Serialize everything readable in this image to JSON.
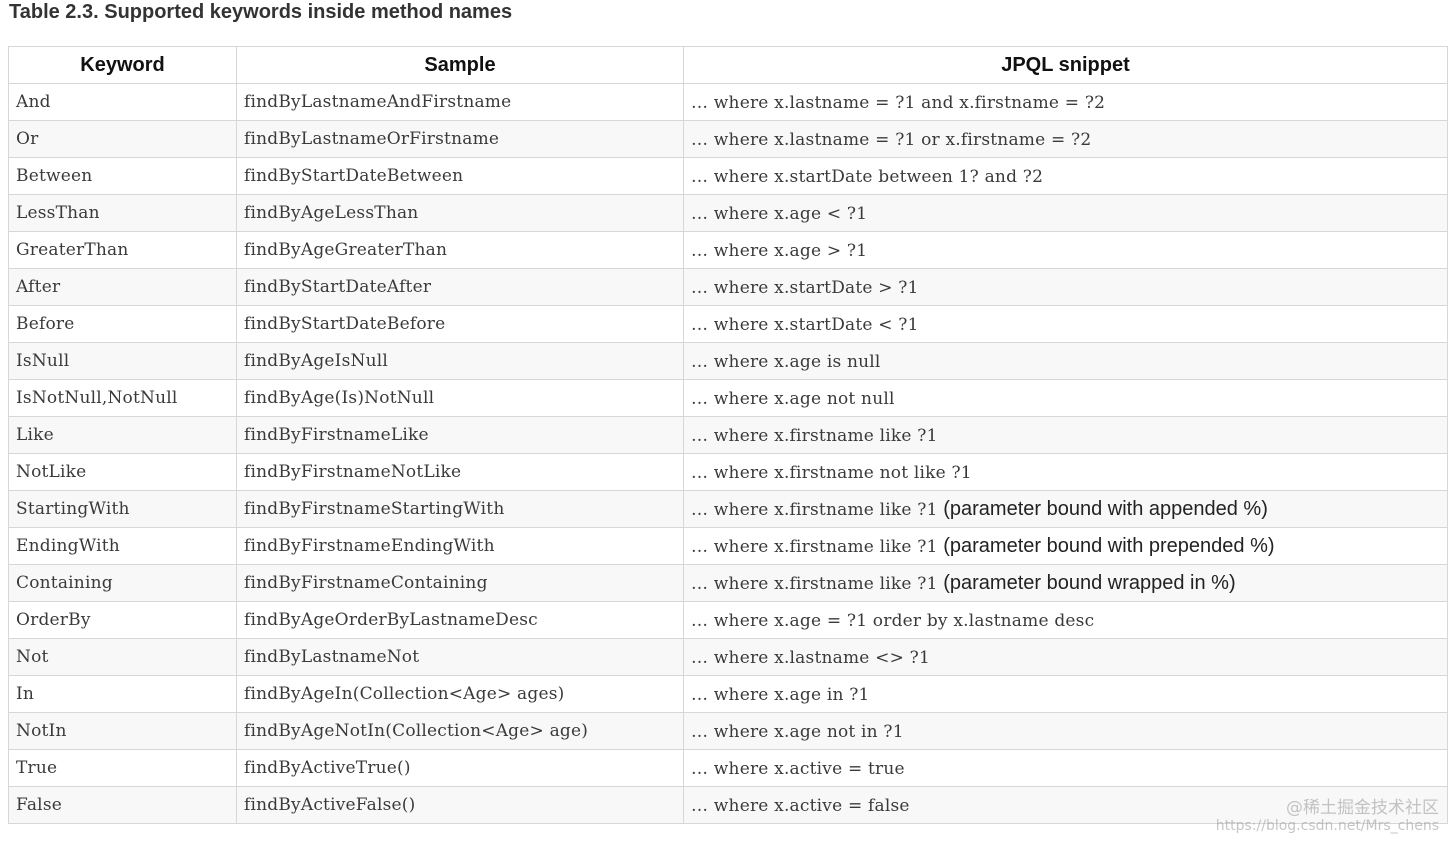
{
  "title": "Table 2.3. Supported keywords inside method names",
  "table": {
    "headers": [
      "Keyword",
      "Sample",
      "JPQL snippet"
    ],
    "rows": [
      {
        "keyword": "And",
        "sample": "findByLastnameAndFirstname",
        "jpql": "… where x.lastname = ?1 and x.firstname = ?2",
        "note": ""
      },
      {
        "keyword": "Or",
        "sample": "findByLastnameOrFirstname",
        "jpql": "… where x.lastname = ?1 or x.firstname = ?2",
        "note": ""
      },
      {
        "keyword": "Between",
        "sample": "findByStartDateBetween",
        "jpql": "… where x.startDate between 1? and ?2",
        "note": ""
      },
      {
        "keyword": "LessThan",
        "sample": "findByAgeLessThan",
        "jpql": "… where x.age < ?1",
        "note": ""
      },
      {
        "keyword": "GreaterThan",
        "sample": "findByAgeGreaterThan",
        "jpql": "… where x.age > ?1",
        "note": ""
      },
      {
        "keyword": "After",
        "sample": "findByStartDateAfter",
        "jpql": "… where x.startDate > ?1",
        "note": ""
      },
      {
        "keyword": "Before",
        "sample": "findByStartDateBefore",
        "jpql": "… where x.startDate < ?1",
        "note": ""
      },
      {
        "keyword": "IsNull",
        "sample": "findByAgeIsNull",
        "jpql": "… where x.age is null",
        "note": ""
      },
      {
        "keyword": "IsNotNull,NotNull",
        "sample": "findByAge(Is)NotNull",
        "jpql": "… where x.age not null",
        "note": ""
      },
      {
        "keyword": "Like",
        "sample": "findByFirstnameLike",
        "jpql": "… where x.firstname like ?1",
        "note": ""
      },
      {
        "keyword": "NotLike",
        "sample": "findByFirstnameNotLike",
        "jpql": "… where x.firstname not like ?1",
        "note": ""
      },
      {
        "keyword": "StartingWith",
        "sample": "findByFirstnameStartingWith",
        "jpql": "… where x.firstname like ?1",
        "note": "(parameter bound with appended %)"
      },
      {
        "keyword": "EndingWith",
        "sample": "findByFirstnameEndingWith",
        "jpql": "… where x.firstname like ?1",
        "note": "(parameter bound with prepended %)"
      },
      {
        "keyword": "Containing",
        "sample": "findByFirstnameContaining",
        "jpql": "… where x.firstname like ?1",
        "note": "(parameter bound wrapped in %)"
      },
      {
        "keyword": "OrderBy",
        "sample": "findByAgeOrderByLastnameDesc",
        "jpql": "… where x.age = ?1 order by x.lastname desc",
        "note": ""
      },
      {
        "keyword": "Not",
        "sample": "findByLastnameNot",
        "jpql": "… where x.lastname <> ?1",
        "note": ""
      },
      {
        "keyword": "In",
        "sample": "findByAgeIn(Collection<Age> ages)",
        "jpql": "… where x.age in ?1",
        "note": ""
      },
      {
        "keyword": "NotIn",
        "sample": "findByAgeNotIn(Collection<Age> age)",
        "jpql": "… where x.age not in ?1",
        "note": ""
      },
      {
        "keyword": "True",
        "sample": "findByActiveTrue()",
        "jpql": "… where x.active = true",
        "note": ""
      },
      {
        "keyword": "False",
        "sample": "findByActiveFalse()",
        "jpql": "… where x.active = false",
        "note": ""
      }
    ]
  },
  "watermark": {
    "line1": "@稀土掘金技术社区",
    "line2": "https://blog.csdn.net/Mrs_chens"
  }
}
